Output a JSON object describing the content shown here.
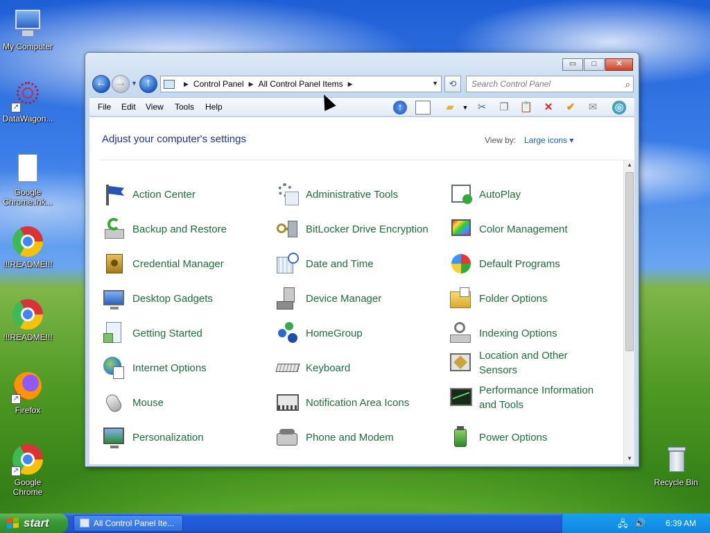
{
  "desktop": {
    "icons": [
      {
        "label": "My Computer"
      },
      {
        "label": "DataWagon..."
      },
      {
        "label": "Google Chrome.lnk..."
      },
      {
        "label": "!!!README!!!"
      },
      {
        "label": "!!!README!!!"
      },
      {
        "label": "Firefox"
      },
      {
        "label": "Google Chrome"
      },
      {
        "label": "Recycle Bin"
      }
    ]
  },
  "window": {
    "address": {
      "segments": [
        "Control Panel",
        "All Control Panel Items"
      ]
    },
    "search_placeholder": "Search Control Panel",
    "menu": [
      "File",
      "Edit",
      "View",
      "Tools",
      "Help"
    ],
    "heading": "Adjust your computer's settings",
    "view_by_label": "View by:",
    "view_by_value": "Large icons",
    "items": [
      "Action Center",
      "Administrative Tools",
      "AutoPlay",
      "Backup and Restore",
      "BitLocker Drive Encryption",
      "Color Management",
      "Credential Manager",
      "Date and Time",
      "Default Programs",
      "Desktop Gadgets",
      "Device Manager",
      "Folder Options",
      "Getting Started",
      "HomeGroup",
      "Indexing Options",
      "Internet Options",
      "Keyboard",
      "Location and Other Sensors",
      "Mouse",
      "Notification Area Icons",
      "Performance Information and Tools",
      "Personalization",
      "Phone and Modem",
      "Power Options"
    ],
    "caption": {
      "minimize": "▭",
      "maximize": "□",
      "close": "✕"
    }
  },
  "taskbar": {
    "start_label": "start",
    "task_label": "All Control Panel Ite...",
    "clock": "6:39 AM"
  },
  "colors": {
    "item_text": "#1d6f3a",
    "heading": "#1e3287",
    "link": "#1a5fb4"
  }
}
